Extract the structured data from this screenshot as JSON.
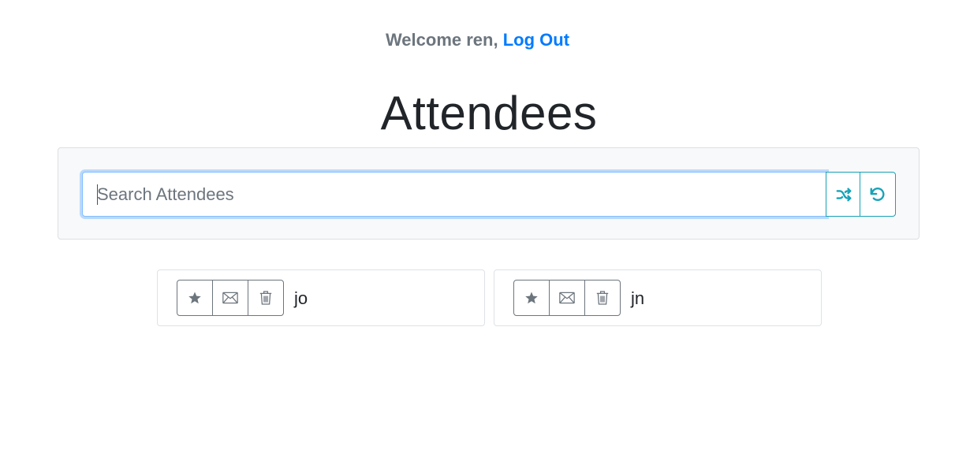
{
  "header": {
    "welcome_prefix": "Welcome ren",
    "separator": ",",
    "logout_label": "Log Out"
  },
  "page": {
    "title": "Attendees"
  },
  "search": {
    "placeholder": "Search Attendees",
    "value": "",
    "shuffle_icon": "shuffle-icon",
    "reset_icon": "undo-icon"
  },
  "attendees": [
    {
      "name": "jo",
      "actions": [
        "star-icon",
        "envelope-icon",
        "trash-icon"
      ]
    },
    {
      "name": "jn",
      "actions": [
        "star-icon",
        "envelope-icon",
        "trash-icon"
      ]
    }
  ],
  "colors": {
    "link": "#007bff",
    "muted": "#6c757d",
    "info": "#17a2b8",
    "panel_bg": "#f8f9fa"
  }
}
